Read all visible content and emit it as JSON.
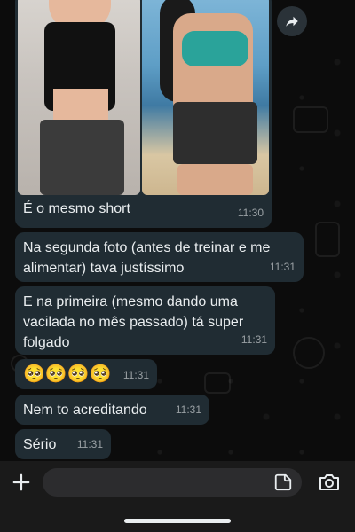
{
  "messages": [
    {
      "type": "image",
      "caption": "É o mesmo short",
      "time": "11:30"
    },
    {
      "type": "text",
      "text": "Na segunda foto (antes de treinar e me alimentar) tava justíssimo",
      "time": "11:31"
    },
    {
      "type": "text",
      "text": "E na primeira (mesmo dando uma vacilada no mês passado) tá super folgado",
      "time": "11:31"
    },
    {
      "type": "text",
      "text": "🥺🥺🥺🥺",
      "time": "11:31"
    },
    {
      "type": "text",
      "text": "Nem to acreditando",
      "time": "11:31"
    },
    {
      "type": "text",
      "text": "Sério",
      "time": "11:31"
    }
  ],
  "composer": {
    "value": "",
    "placeholder": ""
  },
  "icons": {
    "share": "forward-icon",
    "attach": "plus-icon",
    "sticker": "sticker-icon",
    "camera": "camera-icon"
  },
  "colors": {
    "bubble": "#202c33",
    "background": "#0c0c0c",
    "text": "#e9edef"
  }
}
